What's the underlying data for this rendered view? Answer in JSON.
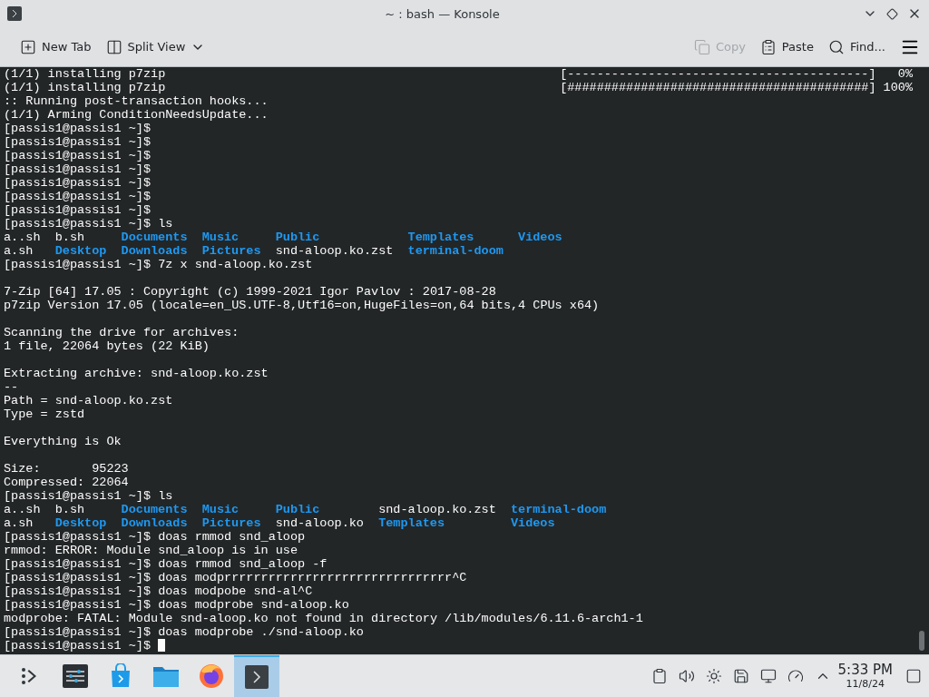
{
  "window": {
    "title": "~ : bash — Konsole"
  },
  "toolbar": {
    "left": [
      {
        "kind": "new-tab",
        "label": "New Tab",
        "disabled": false
      },
      {
        "kind": "split-view",
        "label": "Split View",
        "disabled": false
      }
    ],
    "right": [
      {
        "kind": "copy",
        "label": "Copy",
        "disabled": true
      },
      {
        "kind": "paste",
        "label": "Paste",
        "disabled": false
      },
      {
        "kind": "find",
        "label": "Find...",
        "disabled": false
      }
    ]
  },
  "terminal": {
    "lines": [
      {
        "kind": "output",
        "text": "(1/1) installing p7zip",
        "bar": "[-----------------------------------------]",
        "percent": "0%"
      },
      {
        "kind": "output",
        "text": "(1/1) installing p7zip",
        "bar": "[#########################################]",
        "percent": "100%"
      },
      {
        "kind": "output",
        "text": ":: Running post-transaction hooks..."
      },
      {
        "kind": "output",
        "text": "(1/1) Arming ConditionNeedsUpdate..."
      },
      {
        "kind": "prompt",
        "text": "[passis1@passis1 ~]$",
        "cursor": false
      },
      {
        "kind": "prompt",
        "text": "[passis1@passis1 ~]$",
        "cursor": false
      },
      {
        "kind": "prompt",
        "text": "[passis1@passis1 ~]$",
        "cursor": false
      },
      {
        "kind": "prompt",
        "text": "[passis1@passis1 ~]$",
        "cursor": false
      },
      {
        "kind": "prompt",
        "text": "[passis1@passis1 ~]$",
        "cursor": false
      },
      {
        "kind": "prompt",
        "text": "[passis1@passis1 ~]$",
        "cursor": false
      },
      {
        "kind": "prompt",
        "text": "[passis1@passis1 ~]$",
        "cursor": false
      },
      {
        "kind": "prompt",
        "text": "[passis1@passis1 ~]$ ls",
        "cursor": false
      },
      {
        "kind": "ls",
        "columns": [
          [
            {
              "name": "a..sh",
              "dir": false
            },
            {
              "name": "a.sh",
              "dir": false
            }
          ],
          [
            {
              "name": "b.sh",
              "dir": false
            },
            {
              "name": "Desktop",
              "dir": true
            }
          ],
          [
            {
              "name": "Documents",
              "dir": true
            },
            {
              "name": "Downloads",
              "dir": true
            }
          ],
          [
            {
              "name": "Music",
              "dir": true
            },
            {
              "name": "Pictures",
              "dir": true
            }
          ],
          [
            {
              "name": "Public",
              "dir": true
            },
            {
              "name": "snd-aloop.ko.zst",
              "dir": false
            }
          ],
          [
            {
              "name": "Templates",
              "dir": true
            },
            {
              "name": "terminal-doom",
              "dir": true
            }
          ],
          [
            {
              "name": "Videos",
              "dir": true
            }
          ]
        ]
      },
      {
        "kind": "prompt",
        "text": "[passis1@passis1 ~]$ 7z x snd-aloop.ko.zst",
        "cursor": false
      },
      {
        "kind": "blank"
      },
      {
        "kind": "output",
        "text": "7-Zip [64] 17.05 : Copyright (c) 1999-2021 Igor Pavlov : 2017-08-28"
      },
      {
        "kind": "output",
        "text": "p7zip Version 17.05 (locale=en_US.UTF-8,Utf16=on,HugeFiles=on,64 bits,4 CPUs x64)"
      },
      {
        "kind": "blank"
      },
      {
        "kind": "output",
        "text": "Scanning the drive for archives:"
      },
      {
        "kind": "output",
        "text": "1 file, 22064 bytes (22 KiB)"
      },
      {
        "kind": "blank"
      },
      {
        "kind": "output",
        "text": "Extracting archive: snd-aloop.ko.zst"
      },
      {
        "kind": "output",
        "text": "--"
      },
      {
        "kind": "output",
        "text": "Path = snd-aloop.ko.zst"
      },
      {
        "kind": "output",
        "text": "Type = zstd"
      },
      {
        "kind": "blank"
      },
      {
        "kind": "output",
        "text": "Everything is Ok"
      },
      {
        "kind": "blank"
      },
      {
        "kind": "output",
        "text": "Size:       95223"
      },
      {
        "kind": "output",
        "text": "Compressed: 22064"
      },
      {
        "kind": "prompt",
        "text": "[passis1@passis1 ~]$ ls",
        "cursor": false
      },
      {
        "kind": "ls",
        "columns": [
          [
            {
              "name": "a..sh",
              "dir": false
            },
            {
              "name": "a.sh",
              "dir": false
            }
          ],
          [
            {
              "name": "b.sh",
              "dir": false
            },
            {
              "name": "Desktop",
              "dir": true
            }
          ],
          [
            {
              "name": "Documents",
              "dir": true
            },
            {
              "name": "Downloads",
              "dir": true
            }
          ],
          [
            {
              "name": "Music",
              "dir": true
            },
            {
              "name": "Pictures",
              "dir": true
            }
          ],
          [
            {
              "name": "Public",
              "dir": true
            },
            {
              "name": "snd-aloop.ko",
              "dir": false
            }
          ],
          [
            {
              "name": "snd-aloop.ko.zst",
              "dir": false
            },
            {
              "name": "Templates",
              "dir": true
            }
          ],
          [
            {
              "name": "terminal-doom",
              "dir": true
            },
            {
              "name": "Videos",
              "dir": true
            }
          ]
        ]
      },
      {
        "kind": "prompt",
        "text": "[passis1@passis1 ~]$ doas rmmod snd_aloop",
        "cursor": false
      },
      {
        "kind": "output",
        "text": "rmmod: ERROR: Module snd_aloop is in use"
      },
      {
        "kind": "prompt",
        "text": "[passis1@passis1 ~]$ doas rmmod snd_aloop -f",
        "cursor": false
      },
      {
        "kind": "prompt",
        "text": "[passis1@passis1 ~]$ doas modprrrrrrrrrrrrrrrrrrrrrrrrrrrrrrr^C",
        "cursor": false
      },
      {
        "kind": "prompt",
        "text": "[passis1@passis1 ~]$ doas modpobe snd-al^C",
        "cursor": false
      },
      {
        "kind": "prompt",
        "text": "[passis1@passis1 ~]$ doas modprobe snd-aloop.ko",
        "cursor": false
      },
      {
        "kind": "output",
        "text": "modprobe: FATAL: Module snd-aloop.ko not found in directory /lib/modules/6.11.6-arch1-1"
      },
      {
        "kind": "prompt",
        "text": "[passis1@passis1 ~]$ doas modprobe ./snd-aloop.ko",
        "cursor": false
      },
      {
        "kind": "prompt",
        "text": "[passis1@passis1 ~]$",
        "cursor": true
      }
    ]
  },
  "taskbar": {
    "apps": [
      {
        "kind": "launcher",
        "selected": false
      },
      {
        "kind": "settings",
        "selected": false
      },
      {
        "kind": "store",
        "selected": false
      },
      {
        "kind": "files",
        "selected": false
      },
      {
        "kind": "browser",
        "selected": false
      },
      {
        "kind": "terminal",
        "selected": true
      }
    ],
    "tray": [
      {
        "kind": "clipboard"
      },
      {
        "kind": "volume"
      },
      {
        "kind": "brightness"
      },
      {
        "kind": "disk"
      },
      {
        "kind": "network"
      },
      {
        "kind": "updates"
      },
      {
        "kind": "expand"
      }
    ],
    "time": "5:33 PM",
    "date": "11/8/24"
  }
}
